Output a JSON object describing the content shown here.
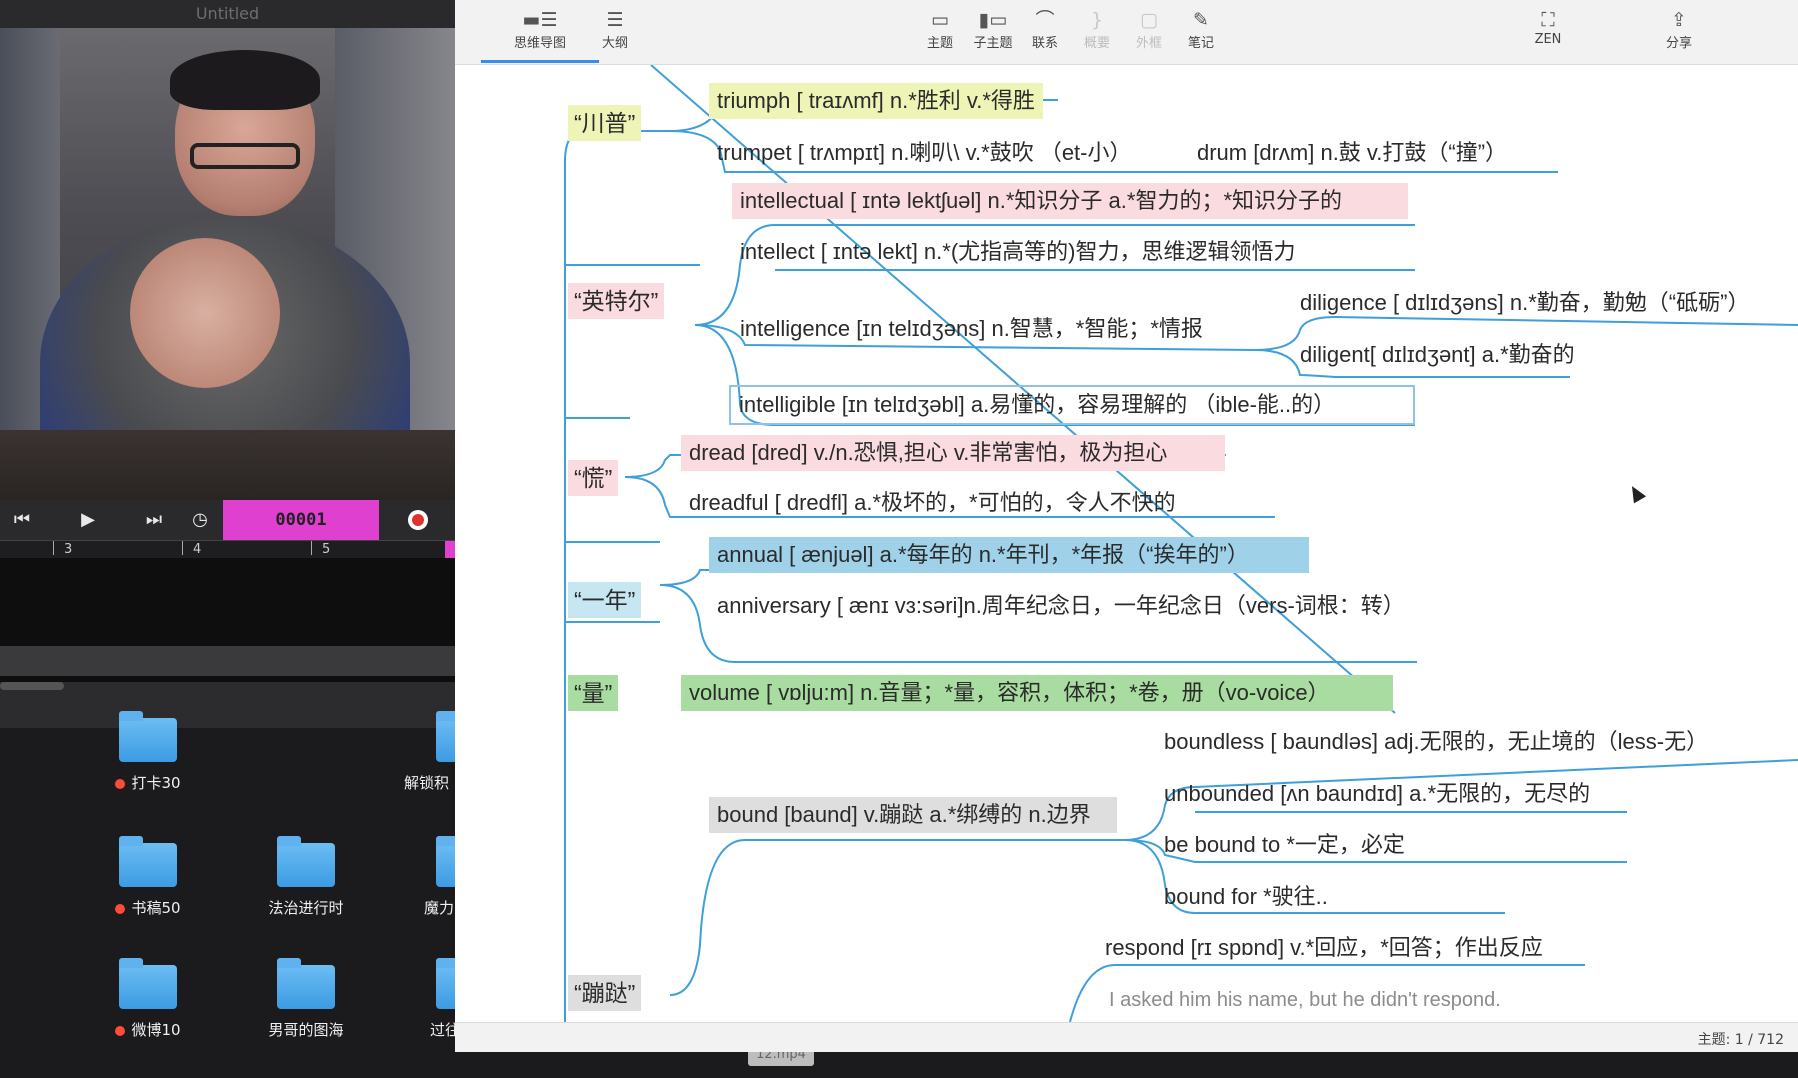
{
  "left_window": {
    "title": "Untitled",
    "counter": "00001",
    "ruler_marks": [
      "3",
      "4",
      "5"
    ]
  },
  "desktop": {
    "items": [
      {
        "label": "打卡30",
        "tag": true
      },
      {
        "label": "解锁积",
        "tag": false
      },
      {
        "label": "书稿50",
        "tag": true
      },
      {
        "label": "法治进行时",
        "tag": false
      },
      {
        "label": "魔力",
        "tag": false
      },
      {
        "label": "微博10",
        "tag": true
      },
      {
        "label": "男哥的图海",
        "tag": false
      },
      {
        "label": "过往",
        "tag": false
      }
    ],
    "video_label": "12.mp4"
  },
  "toolbar": {
    "mindmap_tab": "思维导图",
    "outline_tab": "大纲",
    "topic": "主题",
    "subtopic": "子主题",
    "relation": "联系",
    "summary": "概要",
    "boundary": "外框",
    "note": "笔记",
    "zen": "ZEN",
    "share": "分享"
  },
  "mindmap": {
    "roots": {
      "chuanpu": "“川普”",
      "yingteer": "“英特尔”",
      "huang": "“慌”",
      "yinian": "“一年”",
      "liang": "“量”",
      "bengda": "“蹦跶”"
    },
    "nodes": {
      "triumph": "triumph [ traɪʌmf] n.*胜利  v.*得胜",
      "trumpet": "trumpet [ trʌmpɪt] n.喇叭\\ v.*鼓吹 （et-小）",
      "drum": "drum [drʌm] n.鼓 v.打鼓（“撞”）",
      "intellectual": "intellectual [ ɪntə lektʃuəl] n.*知识分子 a.*智力的；*知识分子的",
      "intellect": "intellect [ ɪntə lekt] n.*(尤指高等的)智力，思维逻辑领悟力",
      "intelligence": "intelligence [ɪn telɪdʒəns] n.智慧，*智能；*情报",
      "diligence": "diligence [ dɪlɪdʒəns] n.*勤奋，勤勉（“砥砺”）",
      "diligent": "diligent[ dɪlɪdʒənt] a.*勤奋的",
      "intelligible": "intelligible [ɪn telɪdʒəbl] a.易懂的，容易理解的 （ible-能..的）",
      "dread": "dread [dred] v./n.恐惧,担心  v.非常害怕，极为担心",
      "dreadful": "dreadful [ dredfl] a.*极坏的，*可怕的，令人不快的",
      "annual": "annual [ ænjuəl] a.*每年的  n.*年刊，*年报（“挨年的”）",
      "anniversary": "anniversary [ ænɪ vɜ:səri]n.周年纪念日，一年纪念日（vers-词根：转）",
      "volume": "volume [ vɒlju:m] n.音量；*量，容积，体积；*卷，册（vo-voice）",
      "bound": "bound [baund] v.蹦跶 a.*绑缚的 n.边界",
      "boundless": "boundless [ baundləs] adj.无限的，无止境的（less-无）",
      "unbounded": "unbounded [ʌn baundɪd] a.*无限的，无尽的",
      "bound_to": "be bound to  *一定，必定",
      "bound_for": "bound for  *驶往..",
      "respond": "respond [rɪ spɒnd] v.*回应，*回答；作出反应",
      "respond_example": "I asked him his name, but he didn't respond."
    }
  },
  "status": {
    "topic_count": "主题: 1 / 712"
  },
  "colors": {
    "branch_line": "#3f9fd8",
    "yellow": "#eef4b5",
    "pink": "#fadbe0",
    "blue": "#9fd2e9",
    "green": "#a9dca0",
    "counter_bg": "#e040d0"
  }
}
